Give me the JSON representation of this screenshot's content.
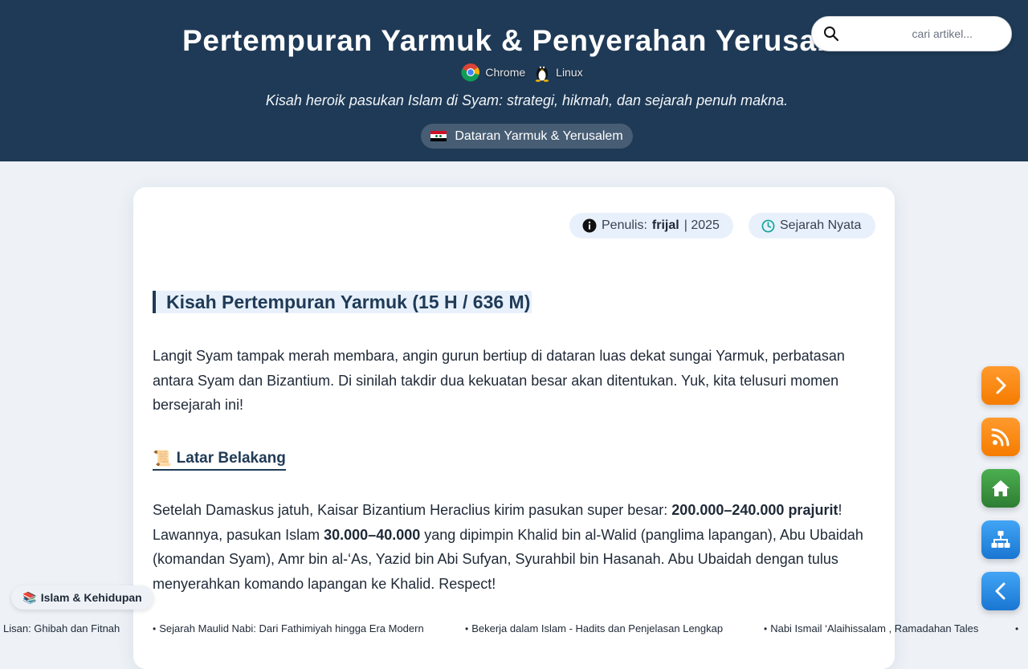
{
  "header": {
    "title": "Pertempuran Yarmuk & Penyerahan Yerusalem",
    "environment": [
      {
        "icon": "chrome-icon",
        "label": "Chrome"
      },
      {
        "icon": "linux-icon",
        "label": "Linux"
      }
    ],
    "tagline": "Kisah heroik pasukan Islam di Syam: strategi, hikmah, dan sejarah penuh makna.",
    "location": "Dataran Yarmuk & Yerusalem",
    "location_icon": "syria-flag-icon"
  },
  "search": {
    "placeholder": "cari artikel...",
    "value": ""
  },
  "meta": {
    "author_label": "Penulis:",
    "author_name": "frijal",
    "year": "| 2025",
    "category": "Sejarah Nyata"
  },
  "article": {
    "heading": "Kisah Pertempuran Yarmuk (15 H / 636 M)",
    "intro": "Langit Syam tampak merah membara, angin gurun bertiup di dataran luas dekat sungai Yarmuk, perbatasan antara Syam dan Bizantium. Di sinilah takdir dua kekuatan besar akan ditentukan. Yuk, kita telusuri momen bersejarah ini!",
    "section_icon": "📜",
    "section_heading": "Latar Belakang",
    "p2": {
      "t1": "Setelah Damaskus jatuh, Kaisar Bizantium Heraclius kirim pasukan super besar: ",
      "b1": "200.000–240.000 prajurit",
      "t2": "! Lawannya, pasukan Islam ",
      "b2": "30.000–40.000",
      "t3": " yang dipimpin Khalid bin al-Walid (panglima lapangan), Abu Ubaidah (komandan Syam), Amr bin al-‘As, Yazid bin Abi Sufyan, Syurahbil bin Hasanah. Abu Ubaidah dengan tulus menyerahkan komando lapangan ke Khalid. Respect!"
    }
  },
  "category_chip": {
    "icon": "📚",
    "label": "Islam & Kehidupan"
  },
  "ticker": [
    "Lisan: Ghibah dan Fitnah",
    "Sejarah Maulid Nabi: Dari Fathimiyah hingga Era Modern",
    "Bekerja dalam Islam - Hadits dan Penjelasan Lengkap",
    "Nabi Ismail ‘Alaihissalam , Ramadahan Tales"
  ],
  "fabs": {
    "next": "chevron-right-icon",
    "rss": "rss-icon",
    "home": "home-icon",
    "sitemap": "sitemap-icon",
    "prev": "chevron-left-icon"
  },
  "colors": {
    "header_bg": "#1f3a56",
    "accent_orange": "#f57c00",
    "accent_green": "#2e7d32",
    "accent_blue": "#1976d2"
  }
}
